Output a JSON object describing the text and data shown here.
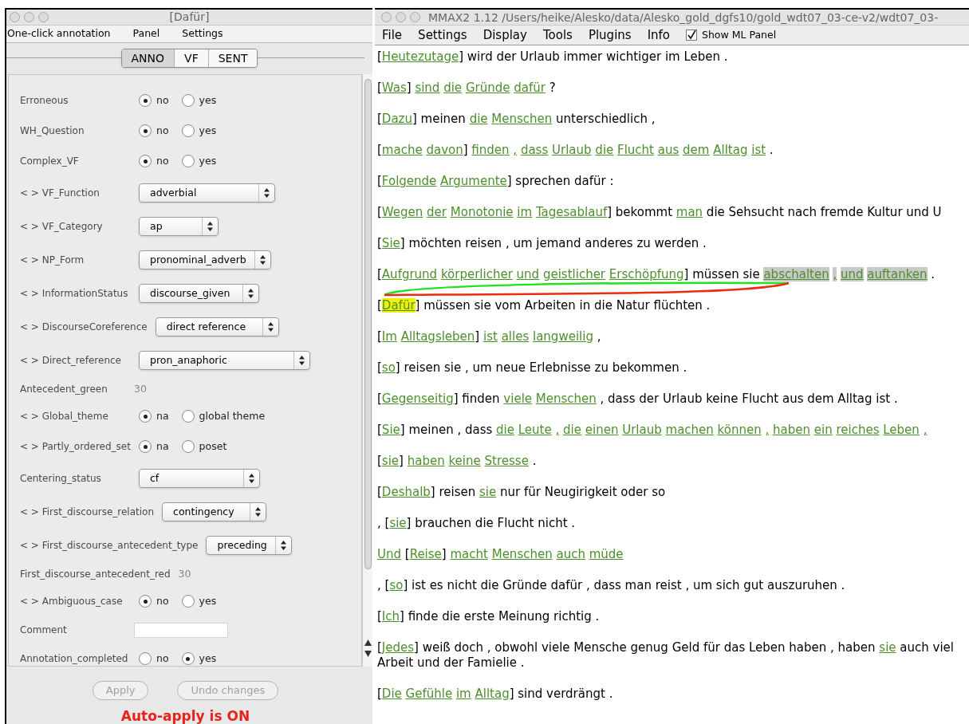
{
  "left_window": {
    "title": "[Dafür]",
    "menu": [
      "One-click annotation",
      "Panel",
      "Settings"
    ],
    "tabs": [
      {
        "label": "ANNO",
        "selected": true
      },
      {
        "label": "VF",
        "selected": false
      },
      {
        "label": "SENT",
        "selected": false
      }
    ],
    "attributes": [
      {
        "kind": "radio",
        "label": "Erroneous",
        "options": [
          {
            "label": "no",
            "selected": true
          },
          {
            "label": "yes",
            "selected": false
          }
        ]
      },
      {
        "kind": "radio",
        "label": "WH_Question",
        "options": [
          {
            "label": "no",
            "selected": true
          },
          {
            "label": "yes",
            "selected": false
          }
        ]
      },
      {
        "kind": "radio",
        "label": "Complex_VF",
        "options": [
          {
            "label": "no",
            "selected": true
          },
          {
            "label": "yes",
            "selected": false
          }
        ]
      },
      {
        "kind": "select",
        "label": "< > VF_Function",
        "value": "adverbial"
      },
      {
        "kind": "select",
        "label": "< > VF_Category",
        "value": "ap"
      },
      {
        "kind": "select",
        "label": "< > NP_Form",
        "value": "pronominal_adverb"
      },
      {
        "kind": "select",
        "label": "< > InformationStatus",
        "value": "discourse_given"
      },
      {
        "kind": "select",
        "label": "< > DiscourseCoreference",
        "value": "direct reference"
      },
      {
        "kind": "select",
        "label": "< > Direct_reference",
        "value": "pron_anaphoric"
      },
      {
        "kind": "value",
        "label": "Antecedent_green",
        "value": "30"
      },
      {
        "kind": "radio",
        "label": "< > Global_theme",
        "options": [
          {
            "label": "na",
            "selected": true
          },
          {
            "label": "global theme",
            "selected": false
          }
        ]
      },
      {
        "kind": "radio",
        "label": "< > Partly_ordered_set",
        "options": [
          {
            "label": "na",
            "selected": true
          },
          {
            "label": "poset",
            "selected": false
          }
        ]
      },
      {
        "kind": "select",
        "label": "Centering_status",
        "value": "cf"
      },
      {
        "kind": "select",
        "label": "< > First_discourse_relation",
        "value": "contingency"
      },
      {
        "kind": "select",
        "label": "< > First_discourse_antecedent_type",
        "value": "preceding"
      },
      {
        "kind": "value",
        "label": "First_discourse_antecedent_red",
        "value": "30"
      },
      {
        "kind": "radio",
        "label": "< > Ambiguous_case",
        "options": [
          {
            "label": "no",
            "selected": true
          },
          {
            "label": "yes",
            "selected": false
          }
        ]
      },
      {
        "kind": "text",
        "label": "Comment"
      },
      {
        "kind": "radio",
        "label": "Annotation_completed",
        "options": [
          {
            "label": "no",
            "selected": false
          },
          {
            "label": "yes",
            "selected": true
          }
        ]
      }
    ],
    "buttons": [
      {
        "label": "Apply",
        "disabled": true
      },
      {
        "label": "Undo changes",
        "disabled": true
      }
    ],
    "status": "Auto-apply is ON"
  },
  "right_window": {
    "title": "MMAX2 1.12 /Users/heike/Alesko/data/Alesko_gold_dgfs10/gold_wdt07_03-ce-v2/wdt07_03-",
    "menu": [
      "File",
      "Settings",
      "Display",
      "Tools",
      "Plugins",
      "Info"
    ],
    "show_ml_panel": {
      "label": "Show ML Panel",
      "checked": true
    },
    "lines": [
      {
        "segments": [
          {
            "kind": "plain",
            "text": "["
          },
          {
            "kind": "markable",
            "text": "Heutezutage"
          },
          {
            "kind": "plain",
            "text": "] wird der Urlaub immer wichtiger im Leben ."
          }
        ]
      },
      {
        "segments": [
          {
            "kind": "plain",
            "text": "["
          },
          {
            "kind": "markable",
            "text": "Was"
          },
          {
            "kind": "plain",
            "text": "] "
          },
          {
            "kind": "markable",
            "text": "sind die Gründe dafür"
          },
          {
            "kind": "plain",
            "text": " ?"
          }
        ]
      },
      {
        "segments": [
          {
            "kind": "plain",
            "text": "["
          },
          {
            "kind": "markable",
            "text": "Dazu"
          },
          {
            "kind": "plain",
            "text": "] meinen "
          },
          {
            "kind": "markable",
            "text": "die Menschen"
          },
          {
            "kind": "plain",
            "text": " unterschiedlich ,"
          }
        ]
      },
      {
        "segments": [
          {
            "kind": "plain",
            "text": "["
          },
          {
            "kind": "markable",
            "text": "mache davon"
          },
          {
            "kind": "plain",
            "text": "] "
          },
          {
            "kind": "markable",
            "text": "finden , dass Urlaub die Flucht aus dem Alltag ist"
          },
          {
            "kind": "plain",
            "text": " ."
          }
        ]
      },
      {
        "segments": [
          {
            "kind": "plain",
            "text": "["
          },
          {
            "kind": "markable",
            "text": "Folgende Argumente"
          },
          {
            "kind": "plain",
            "text": "] sprechen dafür :"
          }
        ]
      },
      {
        "segments": [
          {
            "kind": "plain",
            "text": "["
          },
          {
            "kind": "markable",
            "text": "Wegen der Monotonie im Tagesablauf"
          },
          {
            "kind": "plain",
            "text": "] bekommt "
          },
          {
            "kind": "markable",
            "text": "man"
          },
          {
            "kind": "plain",
            "text": " die Sehsucht nach fremde Kultur und U"
          }
        ]
      },
      {
        "segments": [
          {
            "kind": "plain",
            "text": "["
          },
          {
            "kind": "markable",
            "text": "Sie"
          },
          {
            "kind": "plain",
            "text": "] möchten reisen , um jemand anderes zu werden ."
          }
        ]
      },
      {
        "segments": [
          {
            "kind": "plain",
            "text": "["
          },
          {
            "kind": "markable",
            "text": "Aufgrund körperlicher und geistlicher Erschöpfung"
          },
          {
            "kind": "plain",
            "text": "] müssen sie "
          },
          {
            "kind": "highlighted",
            "text": "abschalten , und auftanken"
          },
          {
            "kind": "plain",
            "text": " ."
          }
        ],
        "arcs": [
          {
            "color": "#22e022"
          },
          {
            "color": "#ee2a10"
          }
        ]
      },
      {
        "segments": [
          {
            "kind": "plain",
            "text": "["
          },
          {
            "kind": "current",
            "text": "Dafür"
          },
          {
            "kind": "plain",
            "text": "] müssen sie vom Arbeiten in die Natur flüchten ."
          }
        ]
      },
      {
        "segments": [
          {
            "kind": "plain",
            "text": "["
          },
          {
            "kind": "markable",
            "text": "Im Alltagsleben"
          },
          {
            "kind": "plain",
            "text": "] "
          },
          {
            "kind": "markable",
            "text": "ist alles langweilig"
          },
          {
            "kind": "plain",
            "text": " ,"
          }
        ]
      },
      {
        "segments": [
          {
            "kind": "plain",
            "text": "["
          },
          {
            "kind": "markable",
            "text": "so"
          },
          {
            "kind": "plain",
            "text": "] reisen sie , um neue Erlebnisse zu bekommen ."
          }
        ]
      },
      {
        "segments": [
          {
            "kind": "plain",
            "text": "["
          },
          {
            "kind": "markable",
            "text": "Gegenseitig"
          },
          {
            "kind": "plain",
            "text": "] finden "
          },
          {
            "kind": "markable",
            "text": "viele Menschen"
          },
          {
            "kind": "plain",
            "text": " , dass der Urlaub keine Flucht aus dem Alltag ist ."
          }
        ]
      },
      {
        "segments": [
          {
            "kind": "plain",
            "text": "["
          },
          {
            "kind": "markable",
            "text": "Sie"
          },
          {
            "kind": "plain",
            "text": "] meinen , dass "
          },
          {
            "kind": "markable",
            "text": "die Leute , die einen Urlaub machen können , haben ein reiches Leben ,"
          }
        ]
      },
      {
        "segments": [
          {
            "kind": "plain",
            "text": "["
          },
          {
            "kind": "markable",
            "text": "sie"
          },
          {
            "kind": "plain",
            "text": "] "
          },
          {
            "kind": "markable",
            "text": "haben keine Stresse"
          },
          {
            "kind": "plain",
            "text": " ."
          }
        ]
      },
      {
        "segments": [
          {
            "kind": "plain",
            "text": "["
          },
          {
            "kind": "markable",
            "text": "Deshalb"
          },
          {
            "kind": "plain",
            "text": "] reisen "
          },
          {
            "kind": "markable",
            "text": "sie"
          },
          {
            "kind": "plain",
            "text": " nur für Neugirigkeit oder so"
          }
        ]
      },
      {
        "segments": [
          {
            "kind": "plain",
            "text": ", ["
          },
          {
            "kind": "markable",
            "text": "sie"
          },
          {
            "kind": "plain",
            "text": "] brauchen die Flucht nicht ."
          }
        ]
      },
      {
        "segments": [
          {
            "kind": "markable",
            "text": "Und"
          },
          {
            "kind": "plain",
            "text": " ["
          },
          {
            "kind": "markable",
            "text": "Reise"
          },
          {
            "kind": "plain",
            "text": "] "
          },
          {
            "kind": "markable",
            "text": "macht Menschen auch müde"
          }
        ]
      },
      {
        "segments": [
          {
            "kind": "plain",
            "text": ", ["
          },
          {
            "kind": "markable",
            "text": "so"
          },
          {
            "kind": "plain",
            "text": "] ist es nicht die Gründe dafür , dass man reist , um sich gut auszuruhen ."
          }
        ]
      },
      {
        "segments": [
          {
            "kind": "plain",
            "text": "["
          },
          {
            "kind": "markable",
            "text": "Ich"
          },
          {
            "kind": "plain",
            "text": "] finde die erste Meinung richtig ."
          }
        ]
      },
      {
        "segments": [
          {
            "kind": "plain",
            "text": "["
          },
          {
            "kind": "markable",
            "text": "Jedes"
          },
          {
            "kind": "plain",
            "text": "] weiß doch , obwohl viele Mensche genug Geld für das Leben haben , haben "
          },
          {
            "kind": "markable",
            "text": "sie"
          },
          {
            "kind": "plain",
            "text": " auch viel"
          },
          {
            "kind": "wrap",
            "text": "Arbeit und der Famielie ."
          }
        ]
      },
      {
        "segments": [
          {
            "kind": "plain",
            "text": "["
          },
          {
            "kind": "markable",
            "text": "Die Gefühle im Alltag"
          },
          {
            "kind": "plain",
            "text": "] sind verdrängt ."
          }
        ]
      }
    ]
  }
}
